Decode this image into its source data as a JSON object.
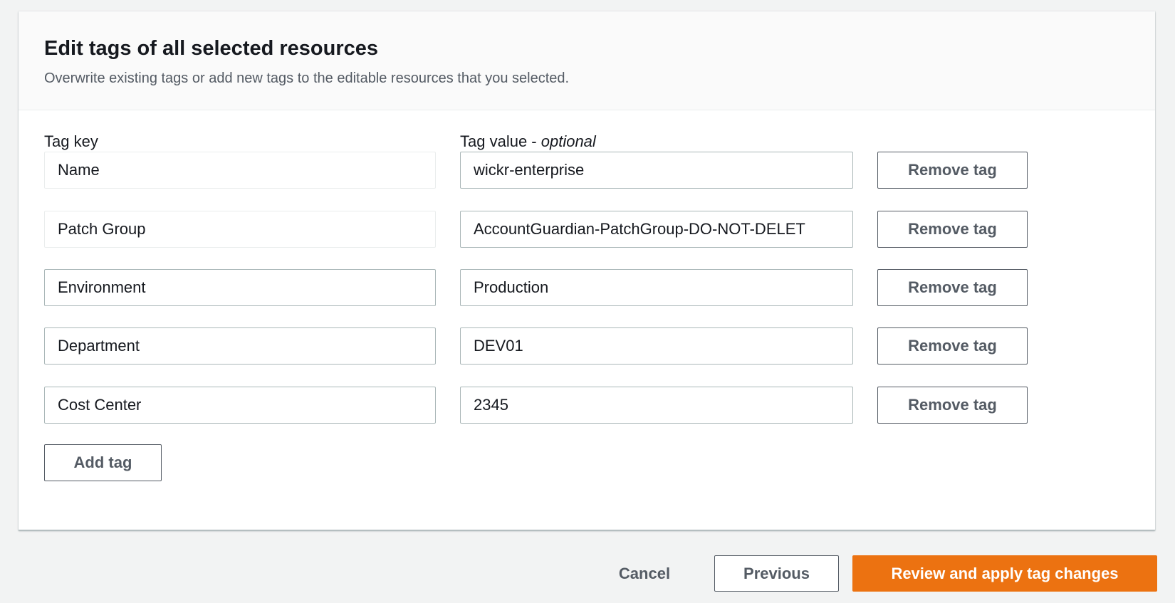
{
  "panel": {
    "title": "Edit tags of all selected resources",
    "description": "Overwrite existing tags or add new tags to the editable resources that you selected."
  },
  "columns": {
    "key_label": "Tag key",
    "value_label": "Tag value - ",
    "value_optional": "optional"
  },
  "tags": [
    {
      "key": "Name",
      "value": "wickr-enterprise",
      "key_editable": false
    },
    {
      "key": "Patch Group",
      "value": "AccountGuardian-PatchGroup-DO-NOT-DELET",
      "key_editable": false
    },
    {
      "key": "Environment",
      "value": "Production",
      "key_editable": true
    },
    {
      "key": "Department",
      "value": "DEV01",
      "key_editable": true
    },
    {
      "key": "Cost Center",
      "value": "2345",
      "key_editable": true
    }
  ],
  "remove_label": "Remove tag",
  "add_label": "Add tag",
  "footer": {
    "cancel_label": "Cancel",
    "previous_label": "Previous",
    "primary_label": "Review and apply tag changes"
  },
  "colors": {
    "primary": "#ec7211",
    "background": "#f2f3f3",
    "border": "#aab7b8"
  }
}
